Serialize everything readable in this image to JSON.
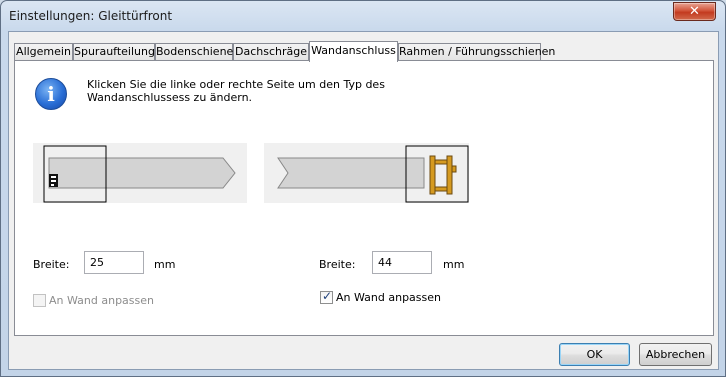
{
  "window": {
    "title": "Einstellungen: Gleittürfront",
    "close_glyph": "✕"
  },
  "tabs": [
    {
      "label": "Allgemein",
      "active": false
    },
    {
      "label": "Spuraufteilung",
      "active": false
    },
    {
      "label": "Bodenschiene",
      "active": false
    },
    {
      "label": "Dachschräge",
      "active": false
    },
    {
      "label": "Wandanschluss",
      "active": true
    },
    {
      "label": "Rahmen / Führungsschienen",
      "active": false
    }
  ],
  "info": {
    "icon": "info-icon",
    "icon_glyph": "i",
    "text": "Klicken Sie die linke oder rechte Seite um den Typ des Wandanschlussess zu ändern."
  },
  "left": {
    "width_label": "Breite:",
    "width_value": "25",
    "unit": "mm",
    "fit_wall_label": "An Wand anpassen",
    "fit_wall_checked": false,
    "fit_wall_enabled": false
  },
  "right": {
    "width_label": "Breite:",
    "width_value": "44",
    "unit": "mm",
    "fit_wall_label": "An Wand anpassen",
    "fit_wall_checked": true,
    "fit_wall_enabled": true
  },
  "buttons": {
    "ok": "OK",
    "cancel": "Abbrechen"
  },
  "colors": {
    "profile_fill": "#d3d3d3",
    "frame_wood": "#d59a20"
  }
}
